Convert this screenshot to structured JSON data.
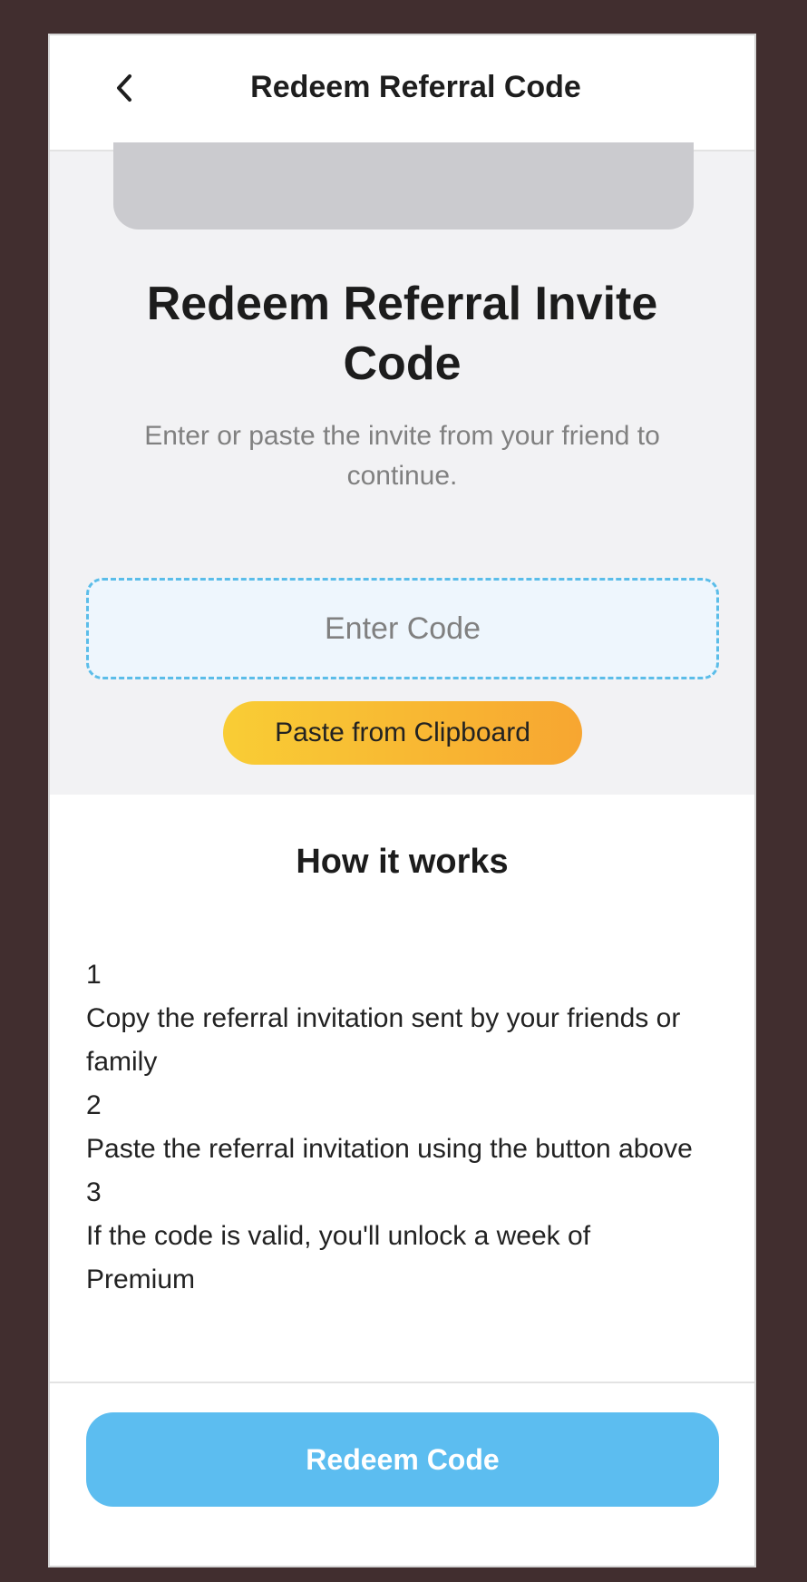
{
  "header": {
    "title": "Redeem Referral Code",
    "back_icon": "chevron-left-icon"
  },
  "hero": {
    "title": "Redeem Referral Invite Code",
    "subtitle": "Enter or paste the invite from your friend to continue."
  },
  "code_input": {
    "placeholder": "Enter Code",
    "value": ""
  },
  "paste_button": {
    "label": "Paste from Clipboard"
  },
  "how_it_works": {
    "title": "How it works",
    "steps": [
      {
        "number": "1",
        "text": "Copy the referral invitation sent by your friends or family"
      },
      {
        "number": "2",
        "text": "Paste the referral invitation using the button above"
      },
      {
        "number": "3",
        "text": "If the code is valid, you'll unlock a week of Premium"
      }
    ]
  },
  "footer": {
    "redeem_label": "Redeem Code"
  },
  "colors": {
    "accent_blue": "#5cbdf0",
    "paste_gradient_start": "#f9cd35",
    "paste_gradient_end": "#f7a631",
    "input_border": "#5bbde9",
    "background_frame": "#412e2f"
  }
}
